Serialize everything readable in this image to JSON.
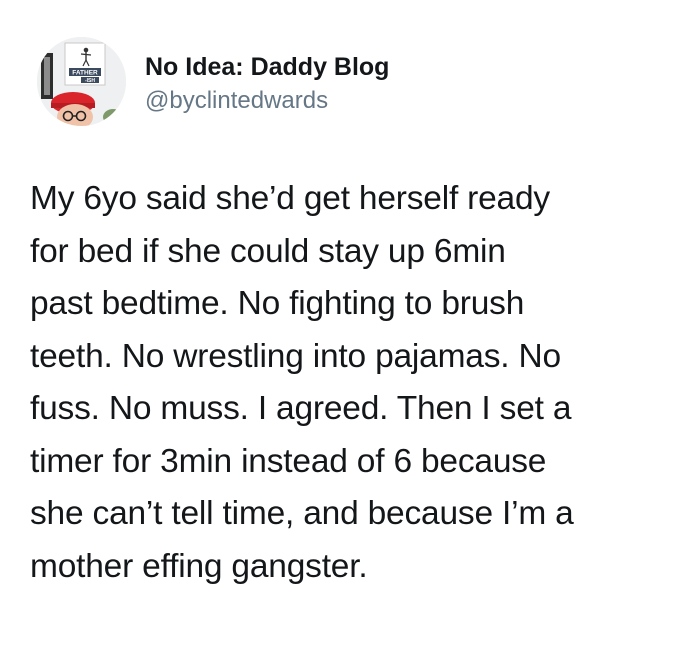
{
  "author": {
    "display_name": "No Idea: Daddy Blog",
    "handle": "@byclintedwards",
    "avatar": {
      "icon": "profile-photo-icon",
      "sign_top": "FATHER",
      "sign_bottom": "-ISH"
    }
  },
  "tweet": {
    "lines": [
      "My 6yo said she’d get herself ready",
      "for bed if she could stay up 6min",
      "past bedtime. No fighting to brush",
      "teeth. No wrestling into pajamas. No",
      "fuss. No muss. I agreed. Then I set a",
      "timer for 3min instead of 6 because",
      "she can’t tell time, and because I’m a",
      "mother effing gangster."
    ]
  },
  "colors": {
    "background": "#ffffff",
    "text": "#14171a",
    "secondary_text": "#657786",
    "hat": "#d8242a"
  }
}
